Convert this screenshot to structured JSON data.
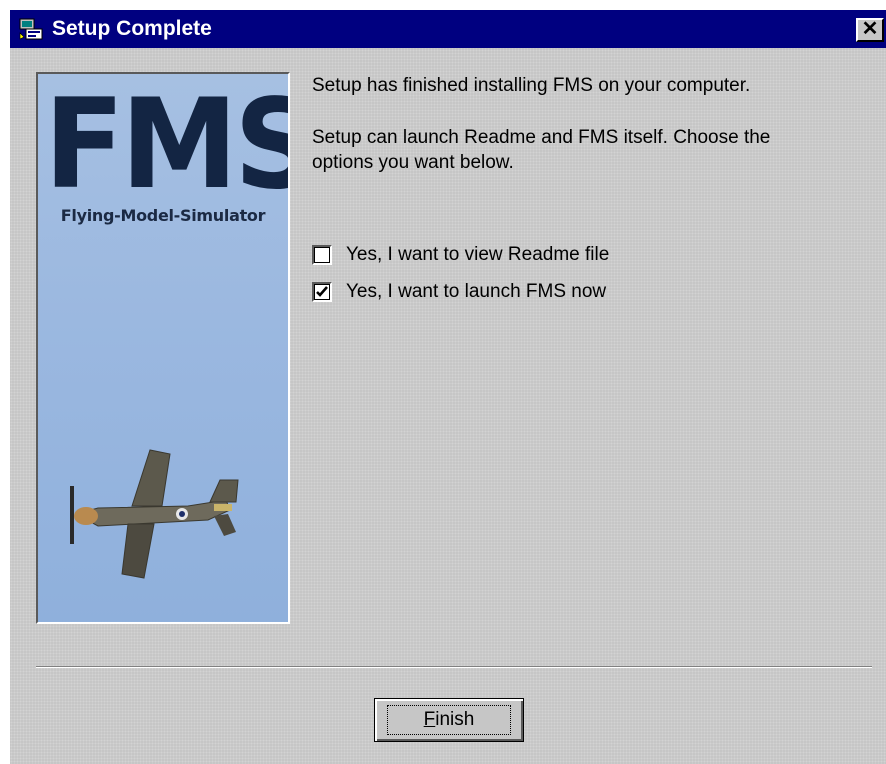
{
  "window": {
    "title": "Setup Complete",
    "close_glyph": "✕",
    "title_icon": "setup-installer-icon",
    "colors": {
      "titlebar": "#000080",
      "face": "#c6c6c6"
    }
  },
  "banner": {
    "logo": "FMS",
    "tagline": "Flying-Model-Simulator",
    "image": "airplane-icon"
  },
  "content": {
    "message_1": "Setup has finished installing FMS on your computer.",
    "message_2_line_1": "Setup can launch Readme and FMS itself. Choose the",
    "message_2_line_2": "options you want below."
  },
  "options": [
    {
      "label": "Yes, I want to view Readme file",
      "checked": false
    },
    {
      "label": "Yes, I want to launch FMS now",
      "checked": true
    }
  ],
  "buttons": {
    "finish_mnemonic": "F",
    "finish_rest": "inish"
  }
}
